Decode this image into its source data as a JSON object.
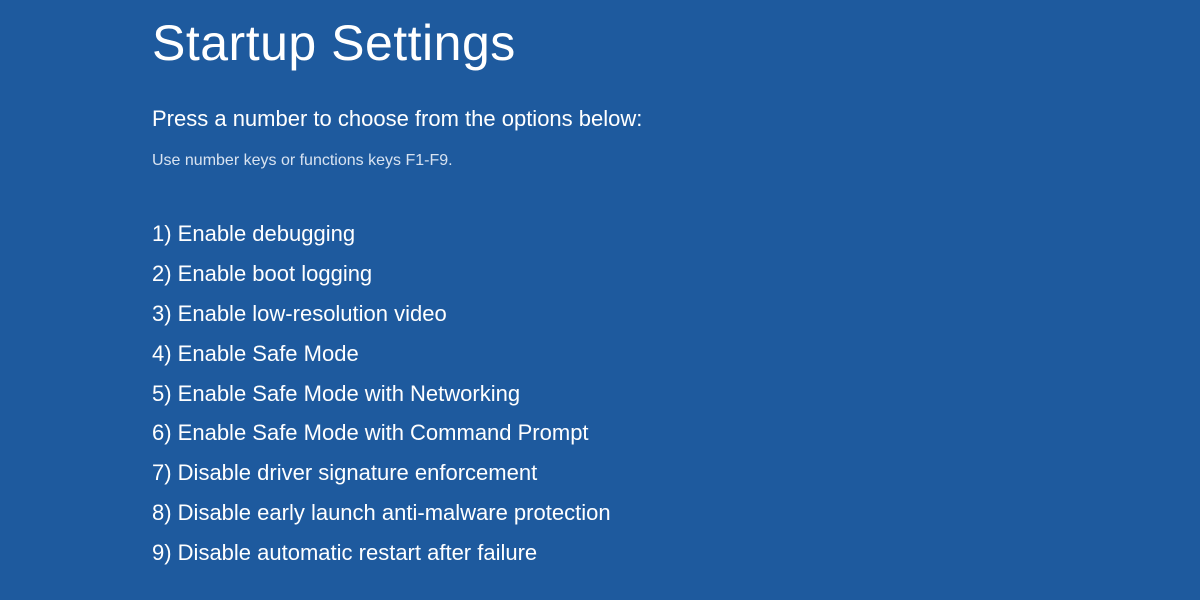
{
  "title": "Startup Settings",
  "instruction": "Press a number to choose from the options below:",
  "hint": "Use number keys or functions keys F1-F9.",
  "options": [
    "1) Enable debugging",
    "2) Enable boot logging",
    "3) Enable low-resolution video",
    "4) Enable Safe Mode",
    "5) Enable Safe Mode with Networking",
    "6) Enable Safe Mode with Command Prompt",
    "7) Disable driver signature enforcement",
    "8) Disable early launch anti-malware protection",
    "9) Disable automatic restart after failure"
  ]
}
